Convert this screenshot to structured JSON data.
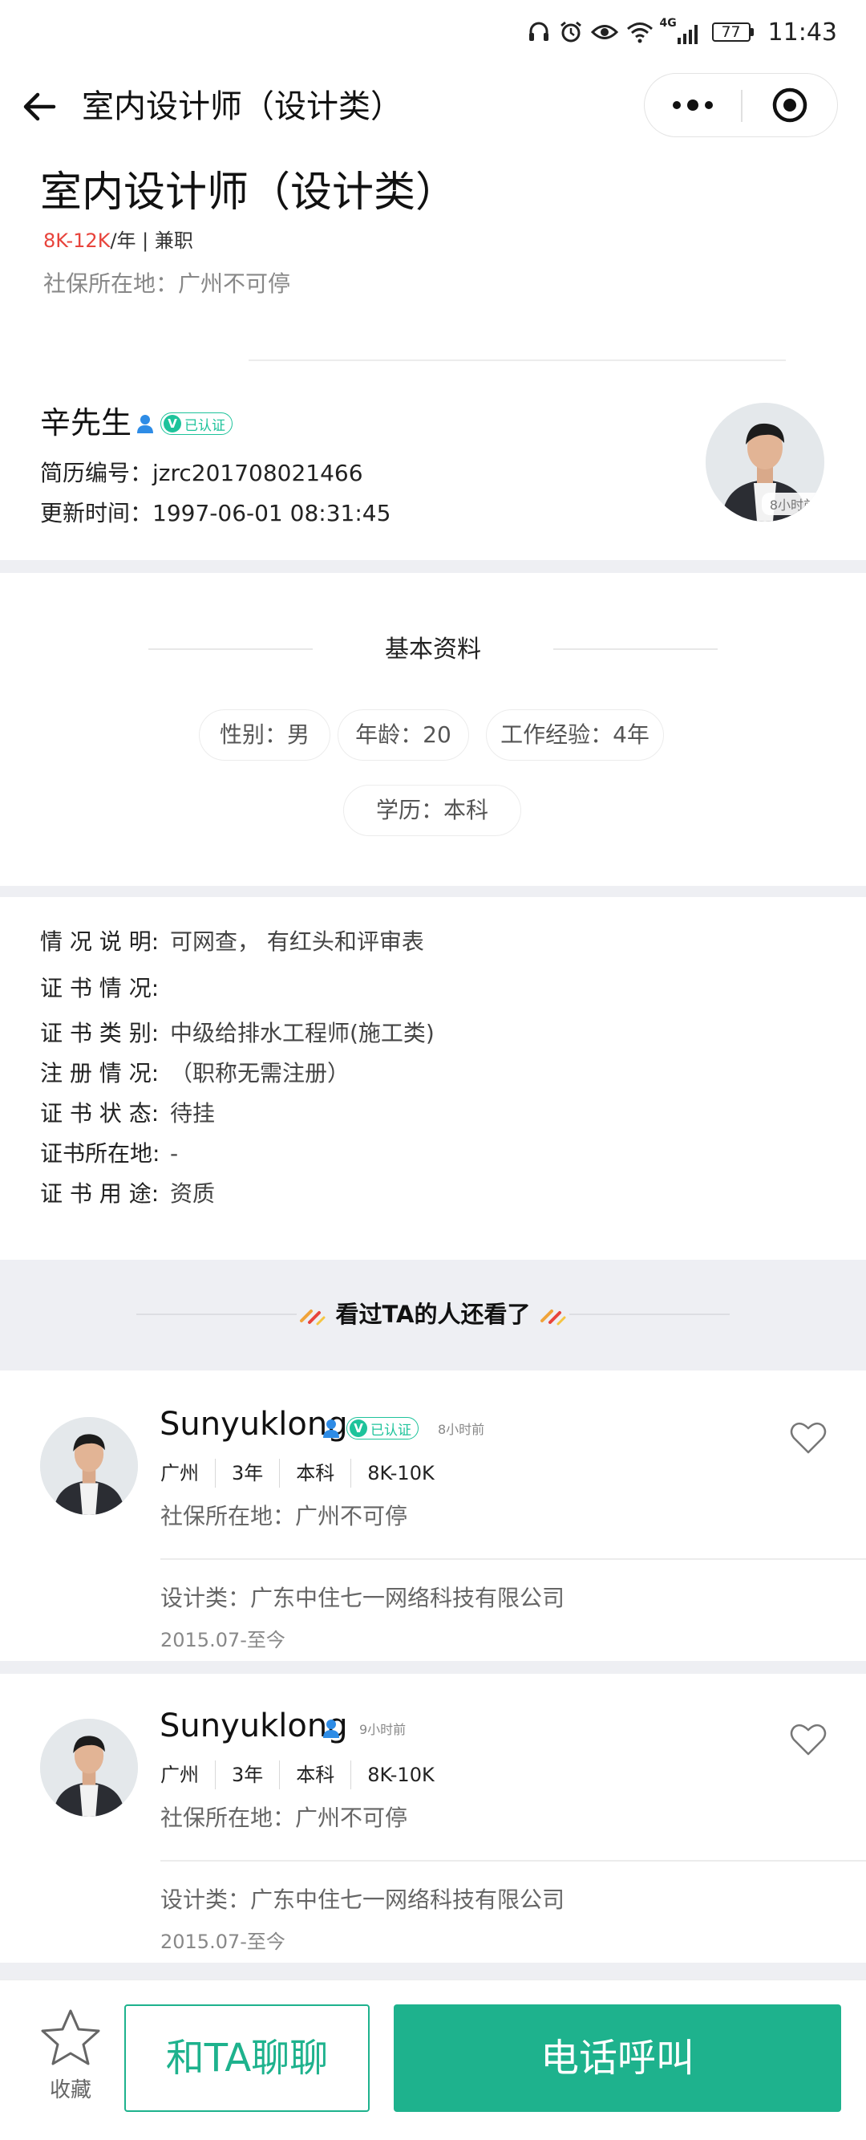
{
  "status_bar": {
    "network": "4G",
    "battery": "77",
    "time": "11:43"
  },
  "nav": {
    "title": "室内设计师（设计类）"
  },
  "header": {
    "title": "室内设计师（设计类）",
    "salary": "8K-12K",
    "salary_suffix": "/年 | 兼职",
    "social_security": "社保所在地：广州不可停"
  },
  "profile": {
    "name": "辛先生",
    "verified_label": "已认证",
    "resume_no_label": "简历编号：",
    "resume_no": "jzrc201708021466",
    "updated_label": "更新时间：",
    "updated": "1997-06-01 08:31:45",
    "avatar_time": "8小时前"
  },
  "basic_info": {
    "title": "基本资料",
    "chips": [
      "性别：男",
      "年龄：20",
      "工作经验：4年",
      "学历：本科"
    ]
  },
  "details": [
    {
      "label": "情 况 说 明:",
      "value": "可网查， 有红头和评审表"
    },
    {
      "label": "证 书 情 况:",
      "value": ""
    },
    {
      "label": "证 书 类 别:",
      "value": "中级给排水工程师(施工类)"
    },
    {
      "label": "注 册 情 况:",
      "value": "（职称无需注册）"
    },
    {
      "label": "证 书 状 态:",
      "value": "待挂"
    },
    {
      "label": "证书所在地:",
      "value": "-"
    },
    {
      "label": "证 书 用 途:",
      "value": "资质"
    }
  ],
  "recommend": {
    "title": "看过TA的人还看了",
    "cards": [
      {
        "name": "Sunyuklong",
        "verified_label": "已认证",
        "time": "8小时前",
        "tags": [
          "广州",
          "3年",
          "本科",
          "8K-10K"
        ],
        "social_security": "社保所在地：广州不可停",
        "company": "设计类：广东中住七一网络科技有限公司",
        "period": "2015.07-至今"
      },
      {
        "name": "Sunyuklong",
        "verified_label": "",
        "time": "9小时前",
        "tags": [
          "广州",
          "3年",
          "本科",
          "8K-10K"
        ],
        "social_security": "社保所在地：广州不可停",
        "company": "设计类：广东中住七一网络科技有限公司",
        "period": "2015.07-至今"
      }
    ]
  },
  "bottom": {
    "favorite_label": "收藏",
    "chat_label": "和TA聊聊",
    "call_label": "电话呼叫"
  },
  "colors": {
    "accent": "#1eb28d",
    "salary": "#e8433b",
    "badge_blue": "#2e8ce6",
    "background_band": "#eeeff3"
  }
}
